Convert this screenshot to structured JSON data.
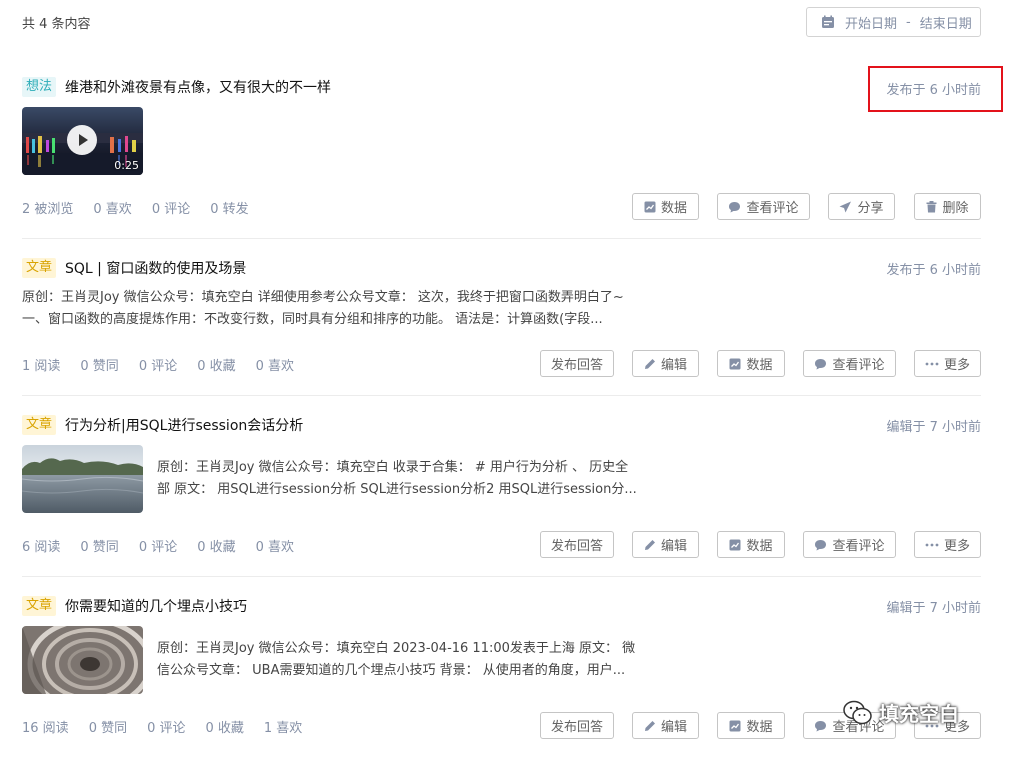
{
  "header": {
    "total": "共 4 条内容",
    "date_start": "开始日期",
    "date_sep": "-",
    "date_end": "结束日期"
  },
  "items": [
    {
      "tag": "想法",
      "title": "维港和外滩夜景有点像，又有很大的不一样",
      "time": "发布于 6 小时前",
      "video_duration": "0:25",
      "stats": [
        "2 被浏览",
        "0 喜欢",
        "0 评论",
        "0 转发"
      ],
      "buttons": [
        "数据",
        "查看评论",
        "分享",
        "删除"
      ]
    },
    {
      "tag": "文章",
      "title": "SQL | 窗口函数的使用及场景",
      "time": "发布于 6 小时前",
      "excerpt_line1": "原创：王肖灵Joy 微信公众号：填充空白 详细使用参考公众号文章： 这次，我终于把窗口函数弄明白了~",
      "excerpt_line2": "一、窗口函数的高度提炼作用：不改变行数，同时具有分组和排序的功能。 语法是：计算函数(字段...",
      "stats": [
        "1 阅读",
        "0 赞同",
        "0 评论",
        "0 收藏",
        "0 喜欢"
      ],
      "buttons": [
        "发布回答",
        "编辑",
        "数据",
        "查看评论",
        "更多"
      ]
    },
    {
      "tag": "文章",
      "title": "行为分析|用SQL进行session会话分析",
      "time": "编辑于 7 小时前",
      "excerpt_line1": "原创：王肖灵Joy 微信公众号：填充空白 收录于合集： # 用户行为分析 、 历史全",
      "excerpt_line2": "部 原文： 用SQL进行session分析 SQL进行session分析2 用SQL进行session分...",
      "stats": [
        "6 阅读",
        "0 赞同",
        "0 评论",
        "0 收藏",
        "0 喜欢"
      ],
      "buttons": [
        "发布回答",
        "编辑",
        "数据",
        "查看评论",
        "更多"
      ]
    },
    {
      "tag": "文章",
      "title": "你需要知道的几个埋点小技巧",
      "time": "编辑于 7 小时前",
      "excerpt_line1": "原创：王肖灵Joy 微信公众号：填充空白 2023-04-16 11:00发表于上海 原文： 微",
      "excerpt_line2": "信公众号文章： UBA需要知道的几个埋点小技巧 背景： 从使用者的角度，用户...",
      "stats": [
        "16 阅读",
        "0 赞同",
        "0 评论",
        "0 收藏",
        "1 喜欢"
      ],
      "buttons": [
        "发布回答",
        "编辑",
        "数据",
        "查看评论",
        "更多"
      ]
    }
  ],
  "watermark": "填充空白",
  "colors": {
    "accent_highlight": "#e3121b",
    "tag_idea": "#2dadb8",
    "tag_article": "#d9a300",
    "muted": "#8590a6"
  }
}
